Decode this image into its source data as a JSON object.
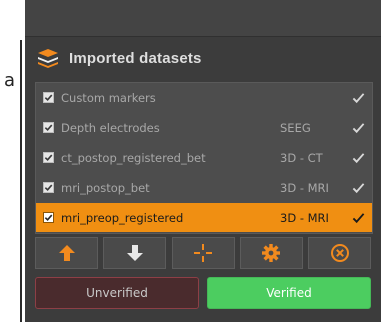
{
  "background_fragment": {
    "char": "a"
  },
  "panel": {
    "title": "Imported datasets",
    "header_icon": "layers-stack-icon"
  },
  "datasets": [
    {
      "name": "Custom markers",
      "type": "",
      "checked": true,
      "selected": false
    },
    {
      "name": "Depth electrodes",
      "type": "SEEG",
      "checked": true,
      "selected": false
    },
    {
      "name": "ct_postop_registered_bet",
      "type": "3D - CT",
      "checked": true,
      "selected": false
    },
    {
      "name": "mri_postop_bet",
      "type": "3D - MRI",
      "checked": true,
      "selected": false
    },
    {
      "name": "mri_preop_registered",
      "type": "3D - MRI",
      "checked": true,
      "selected": true
    }
  ],
  "toolbar": {
    "buttons": [
      {
        "icon": "arrow-up-icon",
        "color": "#f28a1e"
      },
      {
        "icon": "arrow-down-icon",
        "color": "#e8e8e8"
      },
      {
        "icon": "crosshair-icon",
        "color": "#f28a1e"
      },
      {
        "icon": "gear-icon",
        "color": "#f28a1e"
      },
      {
        "icon": "close-circle-icon",
        "color": "#f28a1e"
      }
    ]
  },
  "verification": {
    "unverified_label": "Unverified",
    "verified_label": "Verified",
    "active": "verified"
  },
  "colors": {
    "accent": "#f08f12",
    "verified": "#4ccd60",
    "unverified": "#4a2b2d"
  }
}
